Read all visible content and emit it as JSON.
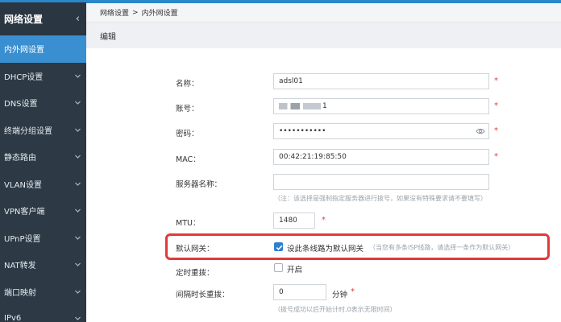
{
  "sidebar": {
    "title": "网络设置",
    "collapse_glyph": "‹",
    "items": [
      {
        "label": "内外网设置",
        "active": true
      },
      {
        "label": "DHCP设置"
      },
      {
        "label": "DNS设置"
      },
      {
        "label": "终端分组设置"
      },
      {
        "label": "静态路由"
      },
      {
        "label": "VLAN设置"
      },
      {
        "label": "VPN客户端"
      },
      {
        "label": "UPnP设置"
      },
      {
        "label": "NAT转发"
      },
      {
        "label": "端口映射"
      },
      {
        "label": "IPv6"
      }
    ]
  },
  "breadcrumb": {
    "parent": "网络设置",
    "separator": ">",
    "current": "内外网设置"
  },
  "section": {
    "title": "编辑"
  },
  "form": {
    "name": {
      "label": "名称：",
      "value": "adsl01",
      "required": "*"
    },
    "account": {
      "label": "账号：",
      "value": "1",
      "required": "*"
    },
    "password": {
      "label": "密码：",
      "value": "•••••••••••",
      "required": "*"
    },
    "mac": {
      "label": "MAC：",
      "value": "00:42:21:19:85:50",
      "required": "*"
    },
    "server": {
      "label": "服务器名称：",
      "value": "",
      "hint": "（注：该选择是强制指定服务器进行拨号，如果没有特殊要求请不要填写）"
    },
    "mtu": {
      "label": "MTU：",
      "value": "1480",
      "required": "*"
    },
    "gateway": {
      "label": "默认网关：",
      "checkbox_label": "设此条线路为默认网关",
      "checked": true,
      "hint": "（当您有多条ISP线路，请选择一条作为默认网关）"
    },
    "scheduled": {
      "label": "定时重拨：",
      "checkbox_label": "开启",
      "checked": false
    },
    "interval": {
      "label": "间隔时长重拨：",
      "value": "0",
      "unit": "分钟",
      "required": "*",
      "hint": "（拨号成功以后开始计时,0表示无限时间）"
    }
  },
  "colors": {
    "accent": "#2a87c9",
    "sidebar_bg": "#2d3a45",
    "active_item": "#3a8fd0",
    "highlight_border": "#e13a3a",
    "required": "#e23b3b"
  }
}
